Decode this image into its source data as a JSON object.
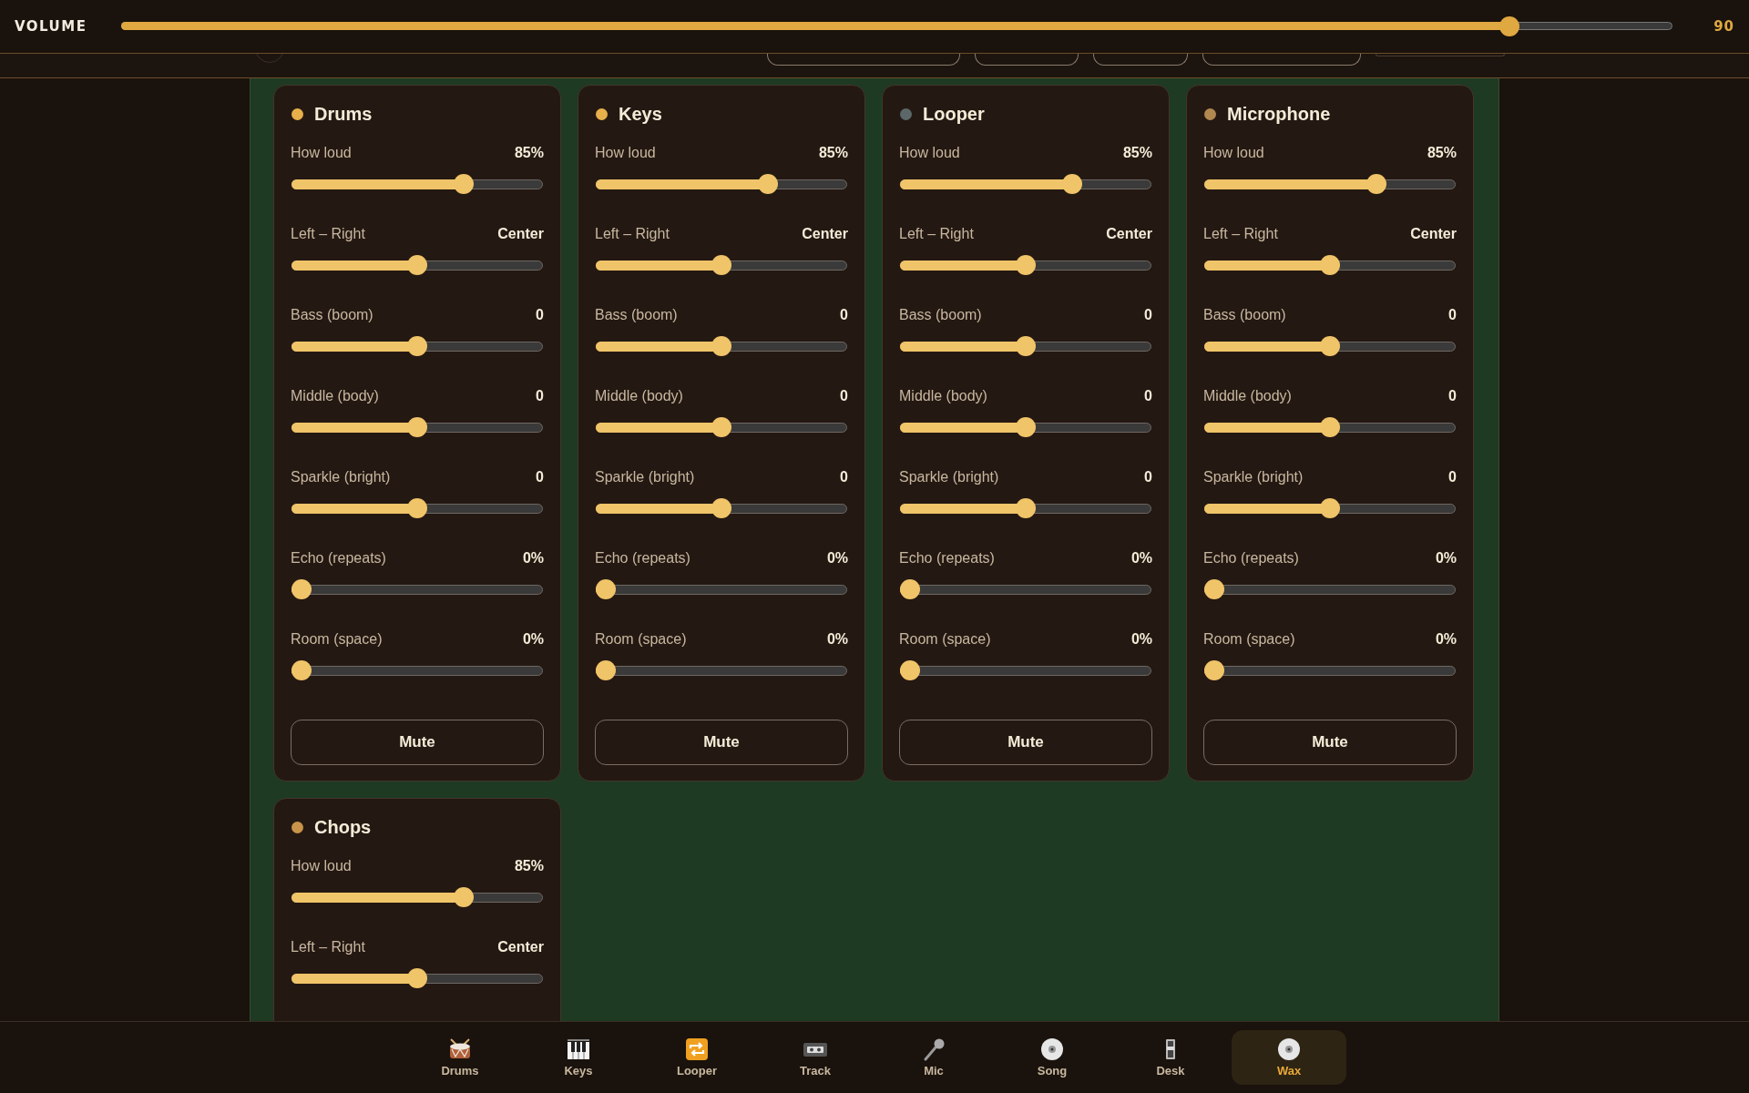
{
  "volume": {
    "label": "VOLUME",
    "level": 0.9,
    "reading": "90"
  },
  "channels": [
    {
      "name": "Drums",
      "color": "#e8b04a",
      "controls": [
        {
          "label": "How loud",
          "reading": "85%",
          "level": 0.7
        },
        {
          "label": "Left – Right",
          "reading": "Center",
          "level": 0.5
        },
        {
          "label": "Bass (boom)",
          "reading": "0",
          "level": 0.5
        },
        {
          "label": "Middle (body)",
          "reading": "0",
          "level": 0.5
        },
        {
          "label": "Sparkle (bright)",
          "reading": "0",
          "level": 0.5
        },
        {
          "label": "Echo (repeats)",
          "reading": "0%",
          "level": 0
        },
        {
          "label": "Room (space)",
          "reading": "0%",
          "level": 0
        }
      ],
      "button": "Mute"
    },
    {
      "name": "Keys",
      "color": "#e8b04a",
      "controls": [
        {
          "label": "How loud",
          "reading": "85%",
          "level": 0.7
        },
        {
          "label": "Left – Right",
          "reading": "Center",
          "level": 0.5
        },
        {
          "label": "Bass (boom)",
          "reading": "0",
          "level": 0.5
        },
        {
          "label": "Middle (body)",
          "reading": "0",
          "level": 0.5
        },
        {
          "label": "Sparkle (bright)",
          "reading": "0",
          "level": 0.5
        },
        {
          "label": "Echo (repeats)",
          "reading": "0%",
          "level": 0
        },
        {
          "label": "Room (space)",
          "reading": "0%",
          "level": 0
        }
      ],
      "button": "Mute"
    },
    {
      "name": "Looper",
      "color": "#5c676a",
      "controls": [
        {
          "label": "How loud",
          "reading": "85%",
          "level": 0.7
        },
        {
          "label": "Left – Right",
          "reading": "Center",
          "level": 0.5
        },
        {
          "label": "Bass (boom)",
          "reading": "0",
          "level": 0.5
        },
        {
          "label": "Middle (body)",
          "reading": "0",
          "level": 0.5
        },
        {
          "label": "Sparkle (bright)",
          "reading": "0",
          "level": 0.5
        },
        {
          "label": "Echo (repeats)",
          "reading": "0%",
          "level": 0
        },
        {
          "label": "Room (space)",
          "reading": "0%",
          "level": 0
        }
      ],
      "button": "Mute"
    },
    {
      "name": "Microphone",
      "color": "#b08850",
      "controls": [
        {
          "label": "How loud",
          "reading": "85%",
          "level": 0.7
        },
        {
          "label": "Left – Right",
          "reading": "Center",
          "level": 0.5
        },
        {
          "label": "Bass (boom)",
          "reading": "0",
          "level": 0.5
        },
        {
          "label": "Middle (body)",
          "reading": "0",
          "level": 0.5
        },
        {
          "label": "Sparkle (bright)",
          "reading": "0",
          "level": 0.5
        },
        {
          "label": "Echo (repeats)",
          "reading": "0%",
          "level": 0
        },
        {
          "label": "Room (space)",
          "reading": "0%",
          "level": 0
        }
      ],
      "button": "Mute"
    },
    {
      "name": "Chops",
      "color": "#c8944a",
      "controls": [
        {
          "label": "How loud",
          "reading": "85%",
          "level": 0.7
        },
        {
          "label": "Left – Right",
          "reading": "Center",
          "level": 0.5
        }
      ]
    }
  ],
  "nav": [
    {
      "label": "Drums",
      "kind": "drum",
      "selected": false
    },
    {
      "label": "Keys",
      "kind": "keys",
      "selected": false
    },
    {
      "label": "Looper",
      "kind": "loop",
      "selected": false
    },
    {
      "label": "Track",
      "kind": "tape",
      "selected": false
    },
    {
      "label": "Mic",
      "kind": "mic",
      "selected": false
    },
    {
      "label": "Song",
      "kind": "disc",
      "selected": false
    },
    {
      "label": "Desk",
      "kind": "fader",
      "selected": false
    },
    {
      "label": "Wax",
      "kind": "disc",
      "selected": true
    }
  ]
}
